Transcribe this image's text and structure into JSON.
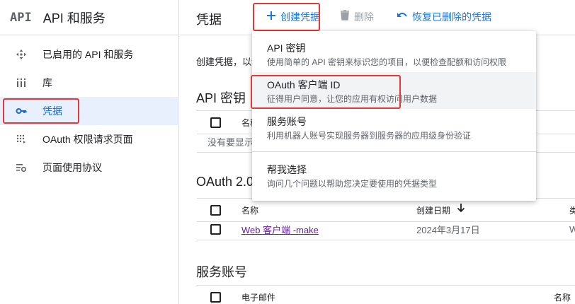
{
  "sidebar": {
    "logo": "API",
    "title": "API 和服务",
    "items": [
      {
        "label": "已启用的 API 和服务"
      },
      {
        "label": "库"
      },
      {
        "label": "凭据"
      },
      {
        "label": "OAuth 权限请求页面"
      },
      {
        "label": "页面使用协议"
      }
    ]
  },
  "toolbar": {
    "title": "凭据",
    "create_label": "创建凭据",
    "delete_label": "删除",
    "restore_label": "恢复已删除的凭据"
  },
  "main": {
    "intro": "创建凭据，以访",
    "api_keys": {
      "title": "API 密钥",
      "col_name": "名称",
      "empty": "没有要显示的"
    },
    "oauth": {
      "title": "OAuth 2.0",
      "col_name": "名称",
      "col_date": "创建日期",
      "col_type": "类",
      "rows": [
        {
          "name": "Web 客户端 -make",
          "date": "2024年3月17日",
          "type": "W"
        }
      ]
    },
    "service": {
      "title": "服务账号",
      "col_email": "电子邮件",
      "col_name": "名称"
    }
  },
  "menu": {
    "items": [
      {
        "title": "API 密钥",
        "desc": "使用简单的 API 密钥来标识您的项目，以便检查配额和访问权限"
      },
      {
        "title": "OAuth 客户端 ID",
        "desc": "征得用户同意，让您的应用有权访问用户数据"
      },
      {
        "title": "服务账号",
        "desc": "利用机器人账号实现服务器到服务器的应用级身份验证"
      },
      {
        "title": "帮我选择",
        "desc": "询问几个问题以帮助您决定要使用的凭据类型"
      }
    ]
  },
  "colors": {
    "accent": "#1a73e8",
    "active_bg": "#e8f0fe",
    "highlight": "#e53935"
  }
}
